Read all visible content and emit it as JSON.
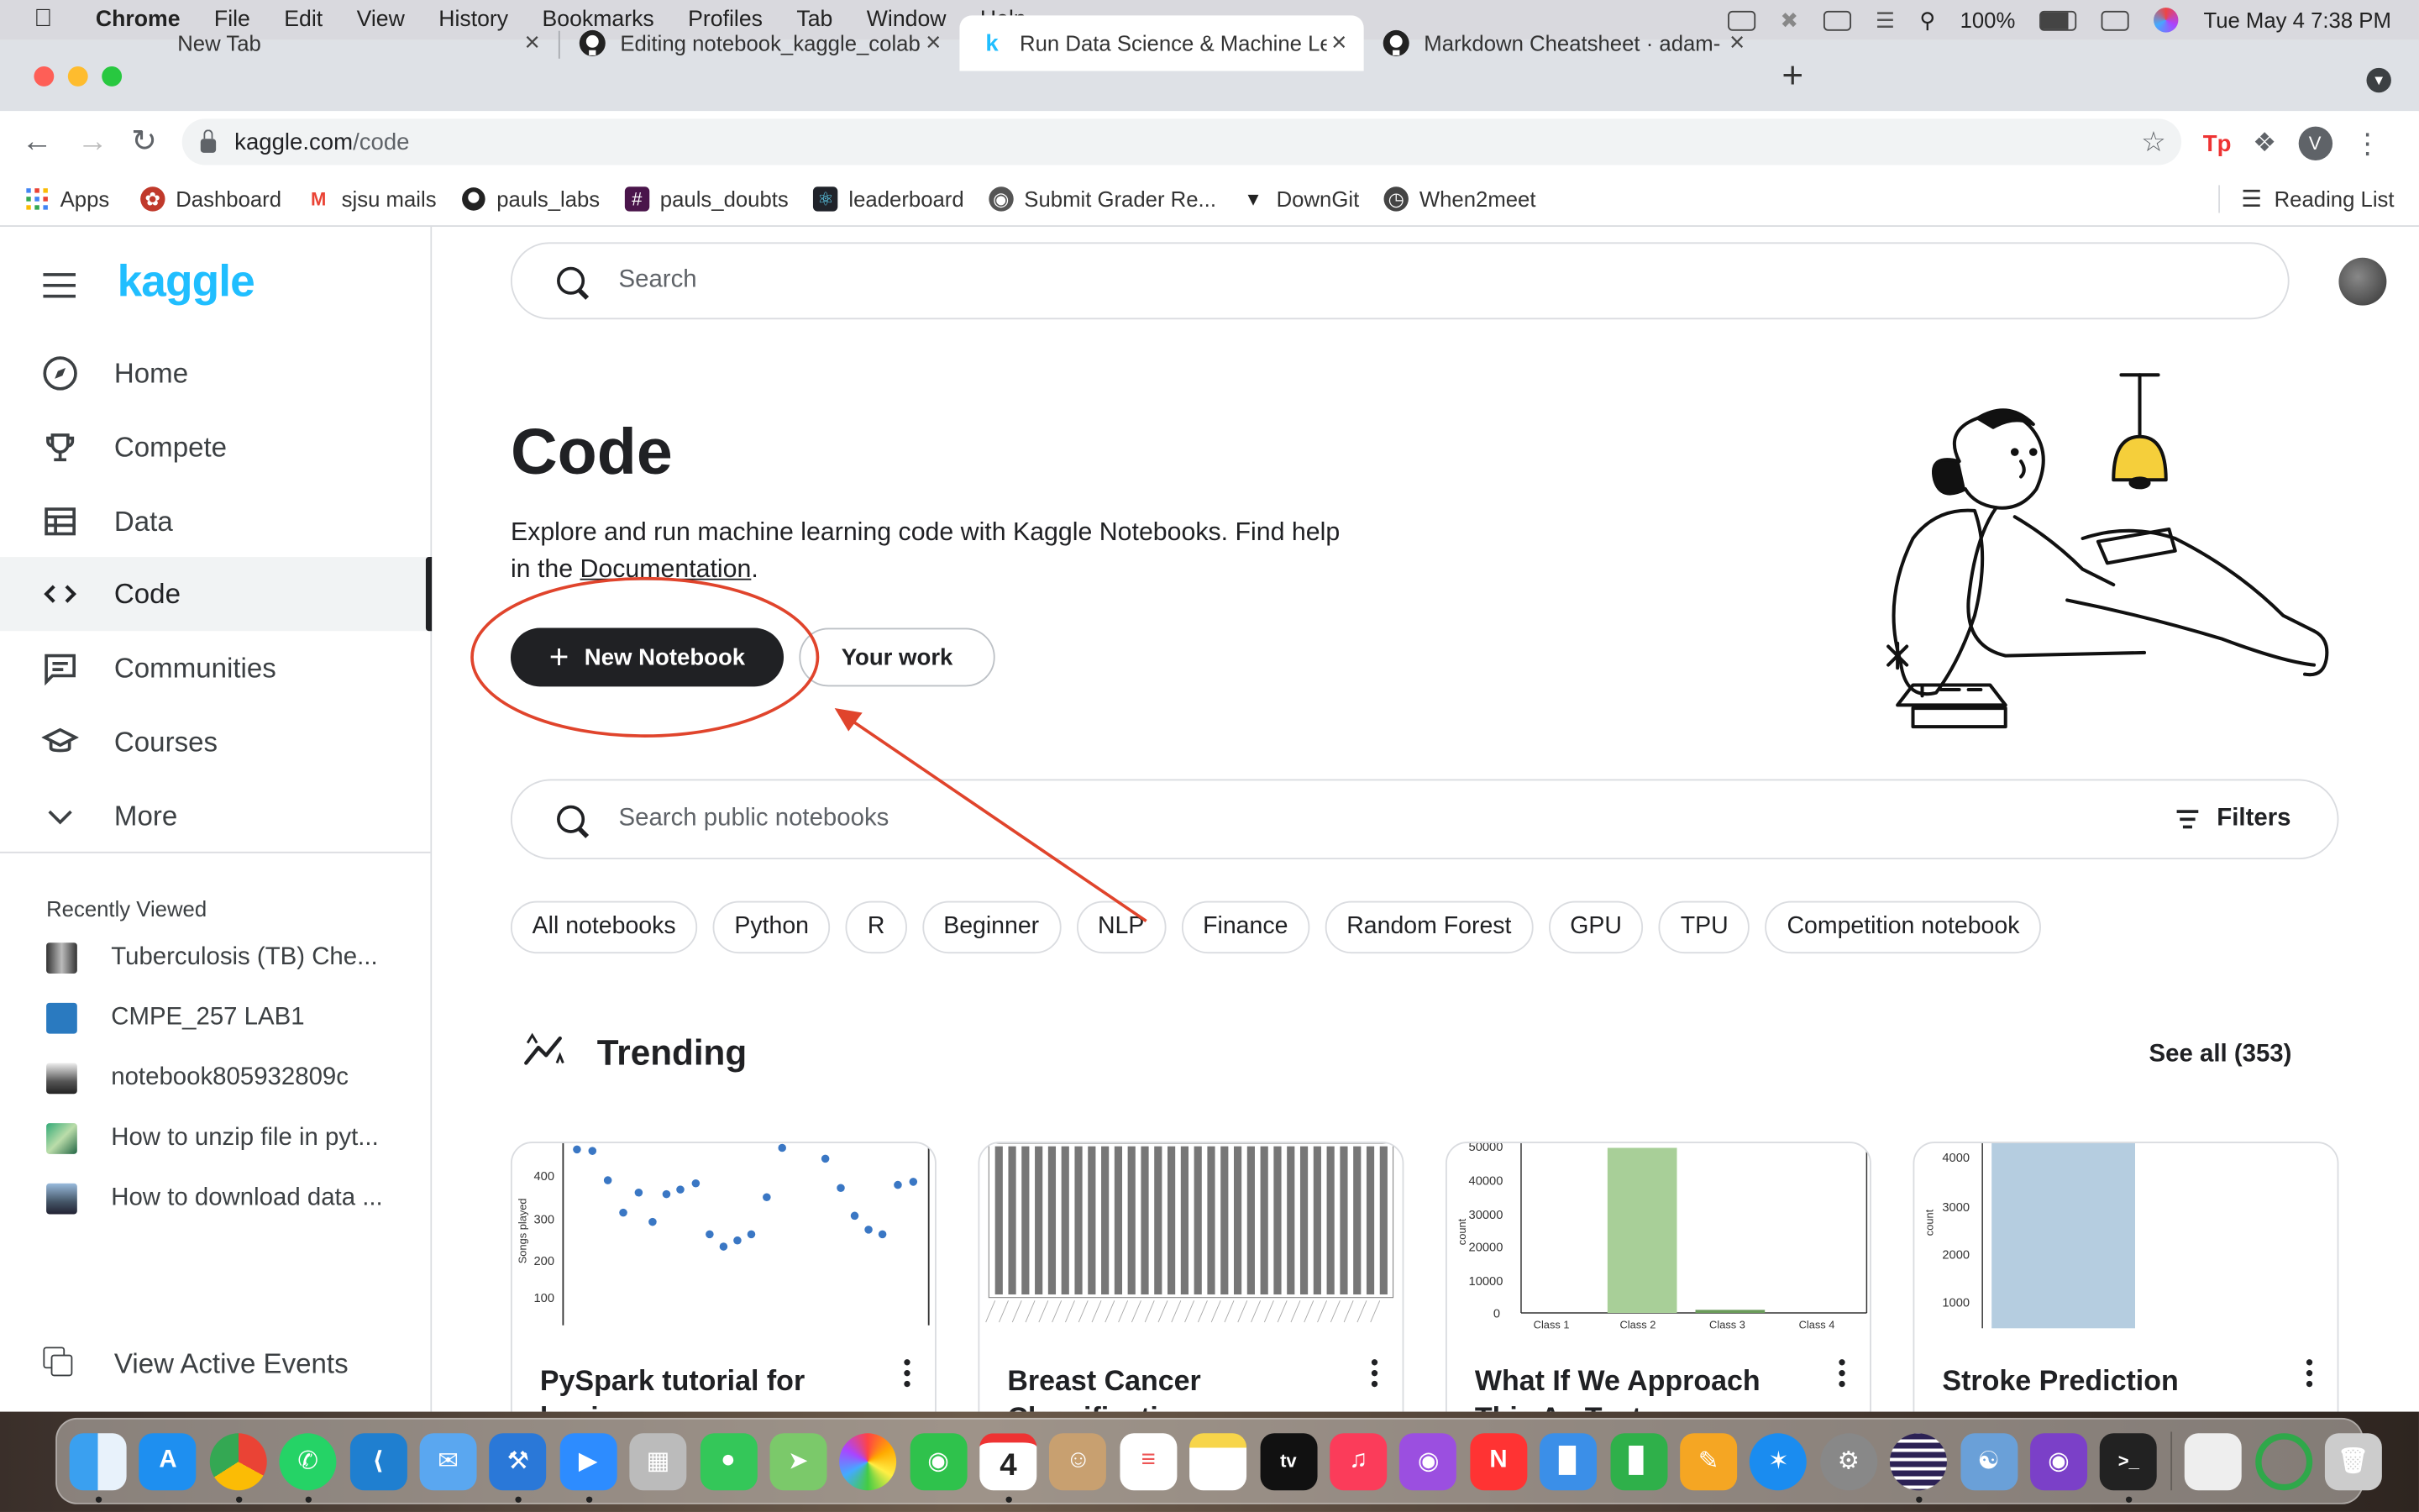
{
  "menubar": {
    "app": "Chrome",
    "items": [
      "File",
      "Edit",
      "View",
      "History",
      "Bookmarks",
      "Profiles",
      "Tab",
      "Window",
      "Help"
    ],
    "battery": "100%",
    "datetime": "Tue May 4  7:38 PM"
  },
  "tabs": [
    {
      "title": "New Tab",
      "icon": "new-tab-icon"
    },
    {
      "title": "Editing notebook_kaggle_colab",
      "icon": "github-icon"
    },
    {
      "title": "Run Data Science & Machine Le",
      "icon": "kaggle-k-icon"
    },
    {
      "title": "Markdown Cheatsheet · adam-",
      "icon": "github-icon"
    }
  ],
  "address": {
    "host": "kaggle.com",
    "path": "/code"
  },
  "profile_initial": "V",
  "bookmarks": [
    {
      "label": "Apps",
      "icon": "apps-grid-icon"
    },
    {
      "label": "Dashboard",
      "icon": "dashboard-icon"
    },
    {
      "label": "sjsu mails",
      "icon": "gmail-icon"
    },
    {
      "label": "pauls_labs",
      "icon": "github-icon"
    },
    {
      "label": "pauls_doubts",
      "icon": "slack-icon"
    },
    {
      "label": "leaderboard",
      "icon": "react-icon"
    },
    {
      "label": "Submit Grader Re...",
      "icon": "globe-icon"
    },
    {
      "label": "DownGit",
      "icon": "downgit-icon"
    },
    {
      "label": "When2meet",
      "icon": "clock-icon"
    }
  ],
  "reading_list": "Reading List",
  "kaggle": {
    "logo": "kaggle",
    "search_placeholder": "Search",
    "nav": [
      {
        "label": "Home",
        "icon": "compass-icon"
      },
      {
        "label": "Compete",
        "icon": "trophy-icon"
      },
      {
        "label": "Data",
        "icon": "table-icon"
      },
      {
        "label": "Code",
        "icon": "code-brackets-icon",
        "active": true
      },
      {
        "label": "Communities",
        "icon": "chat-icon"
      },
      {
        "label": "Courses",
        "icon": "graduation-cap-icon"
      },
      {
        "label": "More",
        "icon": "chevron-down-icon"
      }
    ],
    "recently_viewed_title": "Recently Viewed",
    "recently_viewed": [
      "Tuberculosis (TB) Che...",
      "CMPE_257 LAB1",
      "notebook805932809c",
      "How to unzip file in pyt...",
      "How to download data ..."
    ],
    "view_active_events": "View Active Events"
  },
  "page": {
    "title": "Code",
    "desc_before": "Explore and run machine learning code with Kaggle Notebooks. Find help in the ",
    "desc_link": "Documentation",
    "desc_after": ".",
    "new_notebook": "New Notebook",
    "your_work": "Your work",
    "notebook_search_placeholder": "Search public notebooks",
    "filters": "Filters",
    "chips": [
      "All notebooks",
      "Python",
      "R",
      "Beginner",
      "NLP",
      "Finance",
      "Random Forest",
      "GPU",
      "TPU",
      "Competition notebook"
    ],
    "trending_title": "Trending",
    "see_all": "See all (353)",
    "cards": [
      {
        "title": "PySpark tutorial for beginners",
        "thumb": "scatter"
      },
      {
        "title": "Breast Cancer Classification",
        "thumb": "bars-dense"
      },
      {
        "title": "What If We Approach This As Text",
        "thumb": "bar-class"
      },
      {
        "title": "Stroke Prediction",
        "thumb": "bar-single"
      }
    ]
  },
  "thumbs": {
    "scatter_ylabel": "Songs played",
    "scatter_yticks": [
      "400",
      "300",
      "200",
      "100"
    ],
    "bar_class_yticks": [
      "50000",
      "40000",
      "30000",
      "20000",
      "10000",
      "0"
    ],
    "bar_class_xticks": [
      "Class 1",
      "Class 2",
      "Class 3",
      "Class 4"
    ],
    "bar_class_ylabel": "count",
    "bar_single_yticks": [
      "4000",
      "3000",
      "2000",
      "1000"
    ],
    "bar_single_ylabel": "count"
  },
  "colors": {
    "kaggle_blue": "#20beff",
    "annotation_red": "#e0442c",
    "dark_button": "#202124"
  }
}
